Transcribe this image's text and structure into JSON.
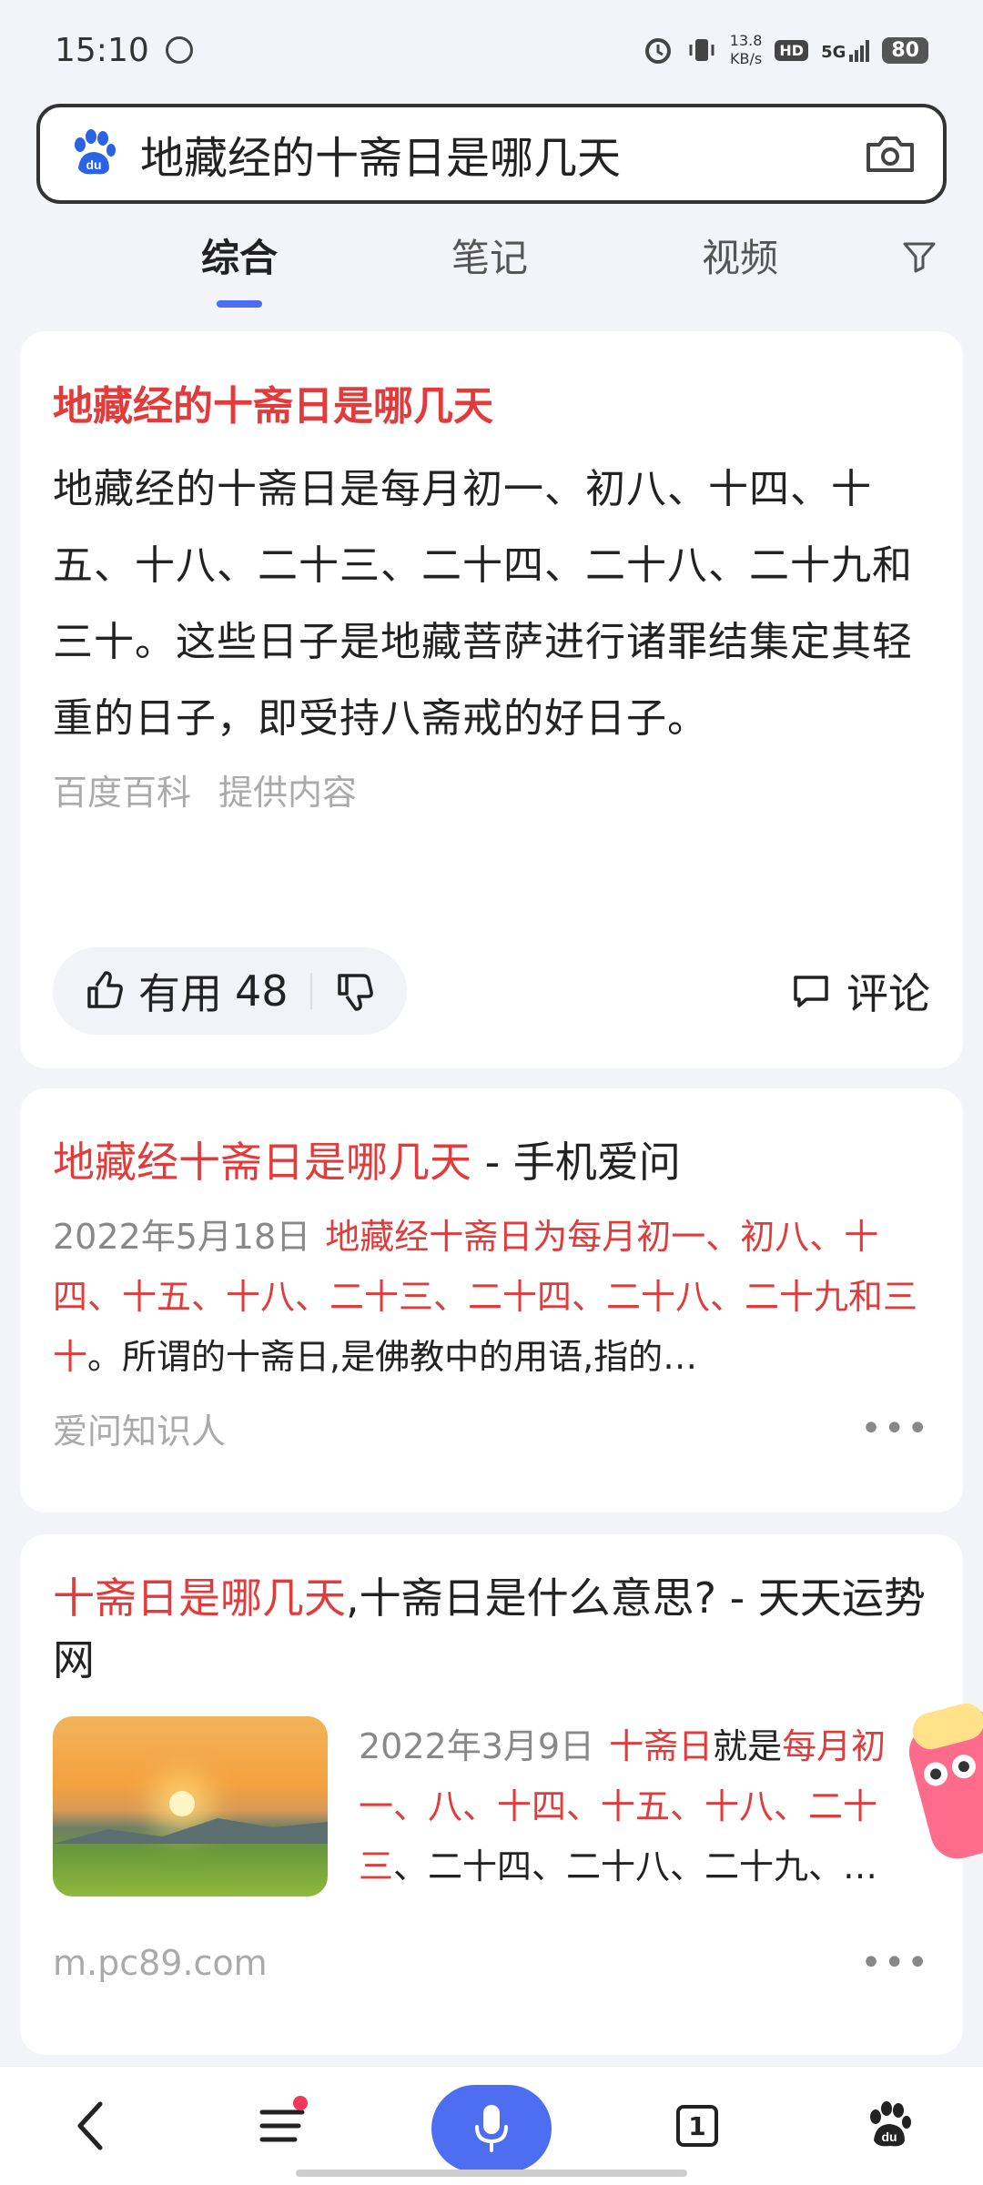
{
  "status_bar": {
    "time": "15:10",
    "speed_value": "13.8",
    "speed_unit": "KB/s",
    "hd": "HD",
    "network": "5G",
    "battery": "80"
  },
  "search": {
    "query": "地藏经的十斋日是哪几天"
  },
  "tabs": [
    {
      "label": "综合",
      "active": true
    },
    {
      "label": "笔记",
      "active": false
    },
    {
      "label": "视频",
      "active": false
    }
  ],
  "result1": {
    "title": "地藏经的十斋日是哪几天",
    "body": "地藏经的十斋日是每月初一、初八、十四、十五、十八、二十三、二十四、二十八、二十九和三十。这些日子是地藏菩萨进行诸罪结集定其轻重的日子，即受持八斋戒的好日子。",
    "source_name": "百度百科",
    "source_suffix": "提供内容",
    "useful_label": "有用",
    "useful_count": "48",
    "comment_label": "评论"
  },
  "result2": {
    "title_highlight": "地藏经十斋日是哪几天",
    "title_rest": " - 手机爱问",
    "date": "2022年5月18日",
    "snippet_highlight": "地藏经十斋日为每月初一、初八、十四、十五、十八、二十三、二十四、二十八、二十九和三十",
    "snippet_rest": "。所谓的十斋日,是佛教中的用语,指的…",
    "source": "爱问知识人"
  },
  "result3": {
    "title_highlight": "十斋日是哪几天",
    "title_rest": ",十斋日是什么意思? - 天天运势网",
    "date": "2022年3月9日",
    "snippet_hl1": "十斋日",
    "snippet_mid": "就是",
    "snippet_hl2": "每月初一、八、十四、十五、十八、二十三",
    "snippet_rest": "、二十四、二十八、二十九、…",
    "source": "m.pc89.com"
  },
  "bottom_nav": {
    "tab_count": "1"
  },
  "colors": {
    "accent": "#4e6ef2",
    "highlight": "#e13b3b"
  }
}
